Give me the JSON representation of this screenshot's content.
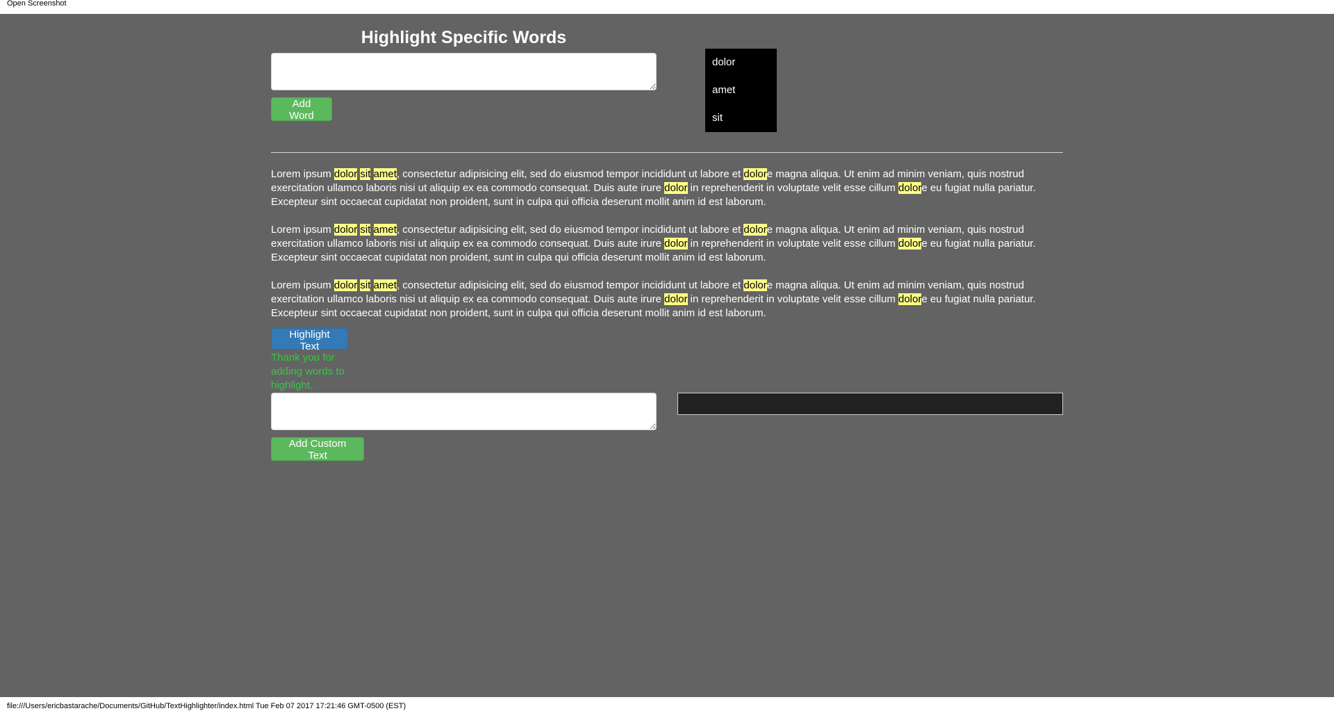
{
  "window": {
    "top_label": "Open Screenshot",
    "footer": "file:///Users/ericbastarache/Documents/GitHub/TextHighlighter/index.html Tue Feb 07 2017 17:21:46 GMT-0500 (EST)"
  },
  "app": {
    "title": "Highlight Specific Words",
    "word_input": {
      "value": "",
      "placeholder": ""
    },
    "add_word_label": "Add Word",
    "words": [
      "dolor",
      "amet",
      "sit"
    ],
    "highlight_button_label": "Highlight Text",
    "thanks_message": "Thank you for adding words to highlight.",
    "custom_input": {
      "value": "",
      "placeholder": ""
    },
    "custom_output": "",
    "add_custom_label": "Add Custom Text",
    "colors": {
      "background": "#636363",
      "highlight": "#ffff88",
      "green_button": "#5cb85c",
      "blue_button": "#337ab7",
      "thanks_text": "#2ecc40",
      "word_list_bg": "#000000"
    }
  },
  "paragraph": {
    "s01": "Lorem ipsum ",
    "w01": "dolor",
    "s02": " ",
    "w02": "sit",
    "s03": " ",
    "w03": "amet",
    "s04": ", consectetur adipisicing elit, sed do eiusmod tempor incididunt ut labore et ",
    "w04": "dolor",
    "s05": "e magna aliqua. Ut enim ad minim veniam, quis nostrud exercitation ullamco laboris nisi ut aliquip ex ea commodo consequat. Duis aute irure ",
    "w05": "dolor",
    "s06": " in reprehenderit in voluptate velit esse cillum ",
    "w06": "dolor",
    "s07": "e eu fugiat nulla pariatur. Excepteur sint occaecat cupidatat non proident, sunt in culpa qui officia deserunt mollit anim id est laborum."
  }
}
